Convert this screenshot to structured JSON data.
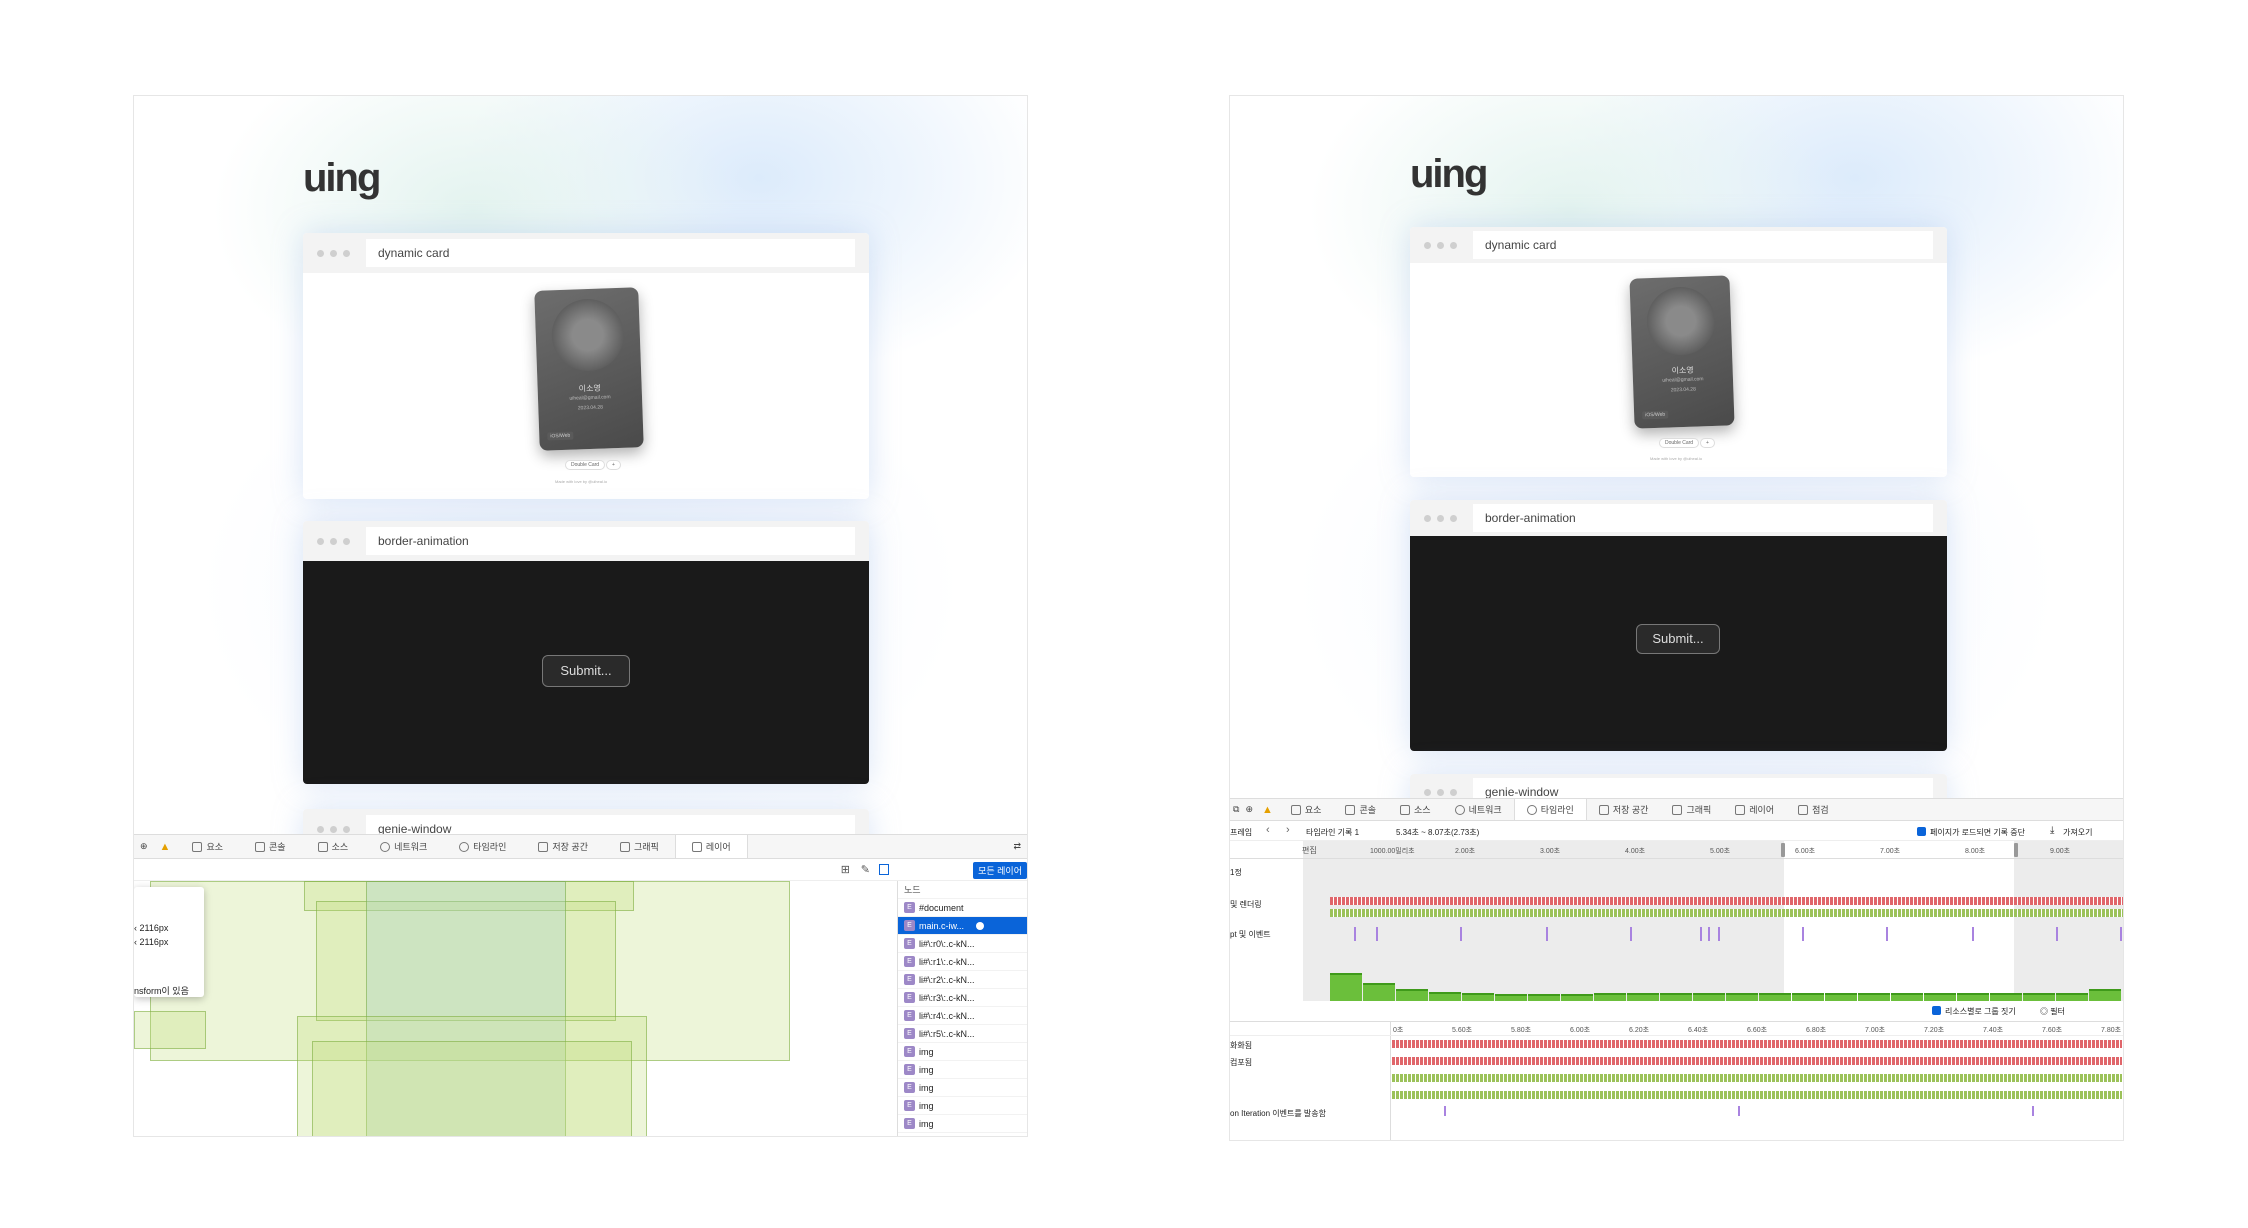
{
  "left": {
    "logo": "uing",
    "windows": [
      {
        "title": "dynamic card"
      },
      {
        "title": "border-animation"
      },
      {
        "title": "genie-window"
      }
    ],
    "card": {
      "name": "이소영",
      "email": "uiheal@gmail.com",
      "line3": "2023.04.28",
      "foot": "iOS/Web",
      "button": "Double Card",
      "plus": "+",
      "credit": "Made with love by @uiheal.io"
    },
    "submit_label": "Submit...",
    "devtools": {
      "tabs": [
        "요소",
        "콘솔",
        "소스",
        "네트워크",
        "타임라인",
        "저장 공간",
        "그래픽",
        "레이어"
      ],
      "active_tab": "레이어",
      "all_layers_button": "모든 레이어",
      "node_header": "노드",
      "nodes": [
        "#document",
        "main.c-iw...",
        "li#\\:r0\\:.c-kN...",
        "li#\\:r1\\:.c-kN...",
        "li#\\:r2\\:.c-kN...",
        "li#\\:r3\\:.c-kN...",
        "li#\\:r4\\:.c-kN...",
        "li#\\:r5\\:.c-kN...",
        "img",
        "img",
        "img",
        "img",
        "img"
      ],
      "tooltip": {
        "w": "‹ 2116px",
        "h": "‹ 2116px",
        "note": "nsform이 있음"
      }
    }
  },
  "right": {
    "logo": "uing",
    "windows": [
      {
        "title": "dynamic card"
      },
      {
        "title": "border-animation"
      },
      {
        "title": "genie-window"
      }
    ],
    "card": {
      "name": "이소영",
      "email": "uiheal@gmail.com",
      "line3": "2023.04.28",
      "foot": "iOS/Web",
      "button": "Double Card",
      "plus": "+",
      "credit": "Made with love by @uiheal.io"
    },
    "submit_label": "Submit...",
    "devtools": {
      "tabs": [
        "요소",
        "콘솔",
        "소스",
        "네트워크",
        "타임라인",
        "저장 공간",
        "그래픽",
        "레이어",
        "점검"
      ],
      "active_tab": "타임라인",
      "toolbar": {
        "frame_label": "프레임",
        "recording": "타임라인 기록 1",
        "range": "5.34초 ~ 8.07초(2.73초)",
        "stop_on_load": "페이지가 로드되면 기록 중단",
        "import": "가져오기"
      },
      "edit_label": "편집",
      "top_ticks": [
        "1000.00밀리초",
        "2.00초",
        "3.00초",
        "4.00초",
        "5.00초",
        "6.00초",
        "7.00초",
        "8.00초",
        "9.00초"
      ],
      "row_labels": [
        "1정",
        "및 렌더링",
        "pt 및 이벤트"
      ],
      "group_by_resource": "리소스별로 그룹 짓기",
      "filter": "필터",
      "bottom_ticks": [
        "0초",
        "5.60초",
        "5.80초",
        "6.00초",
        "6.20초",
        "6.40초",
        "6.60초",
        "6.80초",
        "7.00초",
        "7.20초",
        "7.40초",
        "7.60초",
        "7.80초"
      ],
      "bottom_rows": [
        "화화됨",
        "컴포됨",
        "",
        "",
        "on Iteration 이벤트를 발송함"
      ]
    }
  },
  "colors": {
    "accent": "#0a64d9",
    "layer_green": "#bedc78",
    "timeline_green": "#6bbf3b",
    "timeline_red": "#e0666b",
    "event_purple": "#a983e0"
  }
}
